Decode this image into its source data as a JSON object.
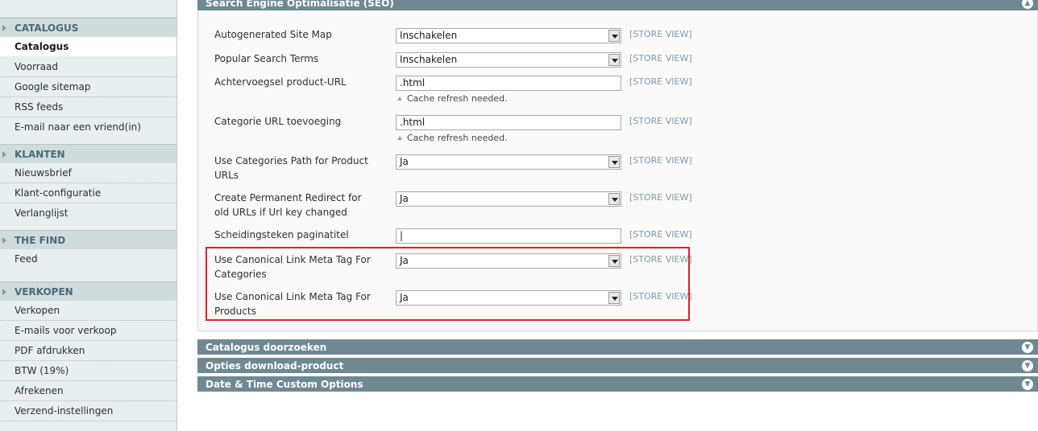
{
  "sidebar": {
    "groups": [
      {
        "title": "CATALOGUS",
        "items": [
          "Catalogus",
          "Voorraad",
          "Google sitemap",
          "RSS feeds",
          "E-mail naar een vriend(in)"
        ]
      },
      {
        "title": "KLANTEN",
        "items": [
          "Nieuwsbrief",
          "Klant-configuratie",
          "Verlanglijst"
        ]
      },
      {
        "title": "THE FIND",
        "items": [
          "Feed"
        ]
      },
      {
        "title": "VERKOPEN",
        "items": [
          "Verkopen",
          "E-mails voor verkoop",
          "PDF afdrukken",
          "BTW (19%)",
          "Afrekenen",
          "Verzend-instellingen"
        ]
      }
    ],
    "active_item": "Catalogus"
  },
  "seo": {
    "title": "Search Engine Optimalisatie (SEO)",
    "scope_label": "[STORE VIEW]",
    "cache_note": "Cache refresh needed.",
    "rows": [
      {
        "label": "Autogenerated Site Map",
        "value": "Inschakelen",
        "type": "select"
      },
      {
        "label": "Popular Search Terms",
        "value": "Inschakelen",
        "type": "select"
      },
      {
        "label": "Achtervoegsel product-URL",
        "value": ".html",
        "type": "text"
      },
      {
        "label": "Categorie URL toevoeging",
        "value": ".html",
        "type": "text"
      },
      {
        "label": "Use Categories Path for Product URLs",
        "value": "Ja",
        "type": "select"
      },
      {
        "label": "Create Permanent Redirect for old URLs if Url key changed",
        "value": "Ja",
        "type": "select"
      },
      {
        "label": "Scheidingsteken paginatitel",
        "value": "|",
        "type": "text"
      },
      {
        "label": "Use Canonical Link Meta Tag For Categories",
        "value": "Ja",
        "type": "select"
      },
      {
        "label": "Use Canonical Link Meta Tag For Products",
        "value": "Ja",
        "type": "select"
      }
    ]
  },
  "collapsed_sections": [
    "Catalogus doorzoeken",
    "Opties download-product",
    "Date & Time Custom Options"
  ],
  "colors": {
    "section_header": "#6f8992",
    "highlight": "#d9232b",
    "sidebar_bg": "#e7efef",
    "scope_text": "#7f9aa5"
  }
}
